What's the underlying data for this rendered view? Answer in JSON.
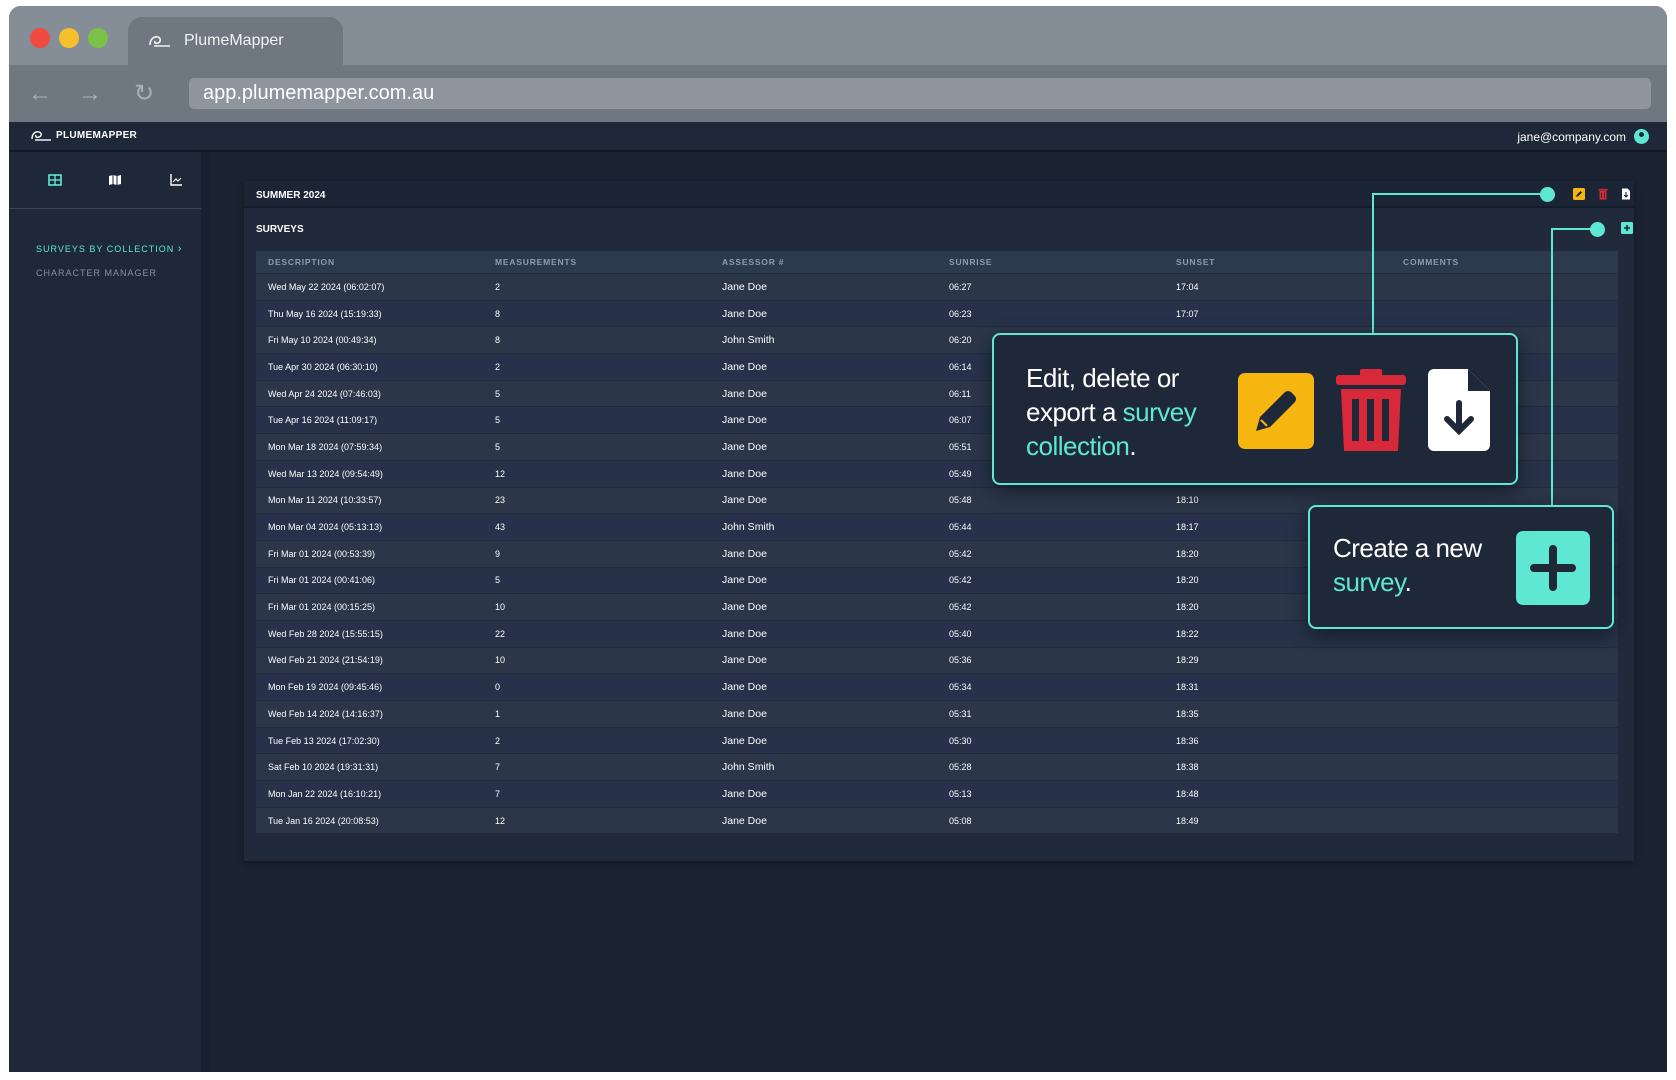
{
  "browser": {
    "tab_title": "PlumeMapper",
    "url": "app.plumemapper.com.au"
  },
  "app": {
    "logo_text": "PLUMEMAPPER",
    "user_email": "jane@company.com"
  },
  "sidebar": {
    "icons": [
      "table-icon",
      "map-icon",
      "chart-icon"
    ],
    "links": [
      {
        "label": "SURVEYS BY COLLECTION",
        "active": true
      },
      {
        "label": "CHARACTER MANAGER",
        "active": false
      }
    ]
  },
  "collection": {
    "title": "SUMMER 2024",
    "actions": [
      "edit-icon",
      "delete-icon",
      "export-icon"
    ]
  },
  "surveys": {
    "title": "SURVEYS",
    "columns": [
      "DESCRIPTION",
      "MEASUREMENTS",
      "ASSESSOR #",
      "SUNRISE",
      "SUNSET",
      "COMMENTS"
    ],
    "rows": [
      [
        "Wed May 22 2024 (06:02:07)",
        "2",
        "Jane Doe",
        "06:27",
        "17:04",
        ""
      ],
      [
        "Thu May 16 2024 (15:19:33)",
        "8",
        "Jane Doe",
        "06:23",
        "17:07",
        ""
      ],
      [
        "Fri May 10 2024 (00:49:34)",
        "8",
        "John Smith",
        "06:20",
        "",
        ""
      ],
      [
        "Tue Apr 30 2024 (06:30:10)",
        "2",
        "Jane Doe",
        "06:14",
        "",
        ""
      ],
      [
        "Wed Apr 24 2024 (07:46:03)",
        "5",
        "Jane Doe",
        "06:11",
        "",
        ""
      ],
      [
        "Tue Apr 16 2024 (11:09:17)",
        "5",
        "Jane Doe",
        "06:07",
        "",
        ""
      ],
      [
        "Mon Mar 18 2024 (07:59:34)",
        "5",
        "Jane Doe",
        "05:51",
        "",
        ""
      ],
      [
        "Wed Mar 13 2024 (09:54:49)",
        "12",
        "Jane Doe",
        "05:49",
        "",
        ""
      ],
      [
        "Mon Mar 11 2024 (10:33:57)",
        "23",
        "Jane Doe",
        "05:48",
        "18:10",
        ""
      ],
      [
        "Mon Mar 04 2024 (05:13:13)",
        "43",
        "John Smith",
        "05:44",
        "18:17",
        ""
      ],
      [
        "Fri Mar 01 2024 (00:53:39)",
        "9",
        "Jane Doe",
        "05:42",
        "18:20",
        ""
      ],
      [
        "Fri Mar 01 2024 (00:41:06)",
        "5",
        "Jane Doe",
        "05:42",
        "18:20",
        ""
      ],
      [
        "Fri Mar 01 2024 (00:15:25)",
        "10",
        "Jane Doe",
        "05:42",
        "18:20",
        ""
      ],
      [
        "Wed Feb 28 2024 (15:55:15)",
        "22",
        "Jane Doe",
        "05:40",
        "18:22",
        ""
      ],
      [
        "Wed Feb 21 2024 (21:54:19)",
        "10",
        "Jane Doe",
        "05:36",
        "18:29",
        ""
      ],
      [
        "Mon Feb 19 2024 (09:45:46)",
        "0",
        "Jane Doe",
        "05:34",
        "18:31",
        ""
      ],
      [
        "Wed Feb 14 2024 (14:16:37)",
        "1",
        "Jane Doe",
        "05:31",
        "18:35",
        ""
      ],
      [
        "Tue Feb 13 2024 (17:02:30)",
        "2",
        "Jane Doe",
        "05:30",
        "18:36",
        ""
      ],
      [
        "Sat Feb 10 2024 (19:31:31)",
        "7",
        "John Smith",
        "05:28",
        "18:38",
        ""
      ],
      [
        "Mon Jan 22 2024 (16:10:21)",
        "7",
        "Jane Doe",
        "05:13",
        "18:48",
        ""
      ],
      [
        "Tue Jan 16 2024 (20:08:53)",
        "12",
        "Jane Doe",
        "05:08",
        "18:49",
        ""
      ]
    ]
  },
  "callouts": {
    "collection": {
      "text_a": "Edit, delete or",
      "text_b": "export a ",
      "accent_a": "survey",
      "accent_b": "collection",
      "tail": "."
    },
    "survey": {
      "text_a": "Create a new",
      "accent": "survey",
      "tail": "."
    }
  },
  "colors": {
    "accent": "#5ee8d3",
    "edit": "#f6b60f",
    "delete": "#d8293a",
    "export": "#ffffff"
  }
}
